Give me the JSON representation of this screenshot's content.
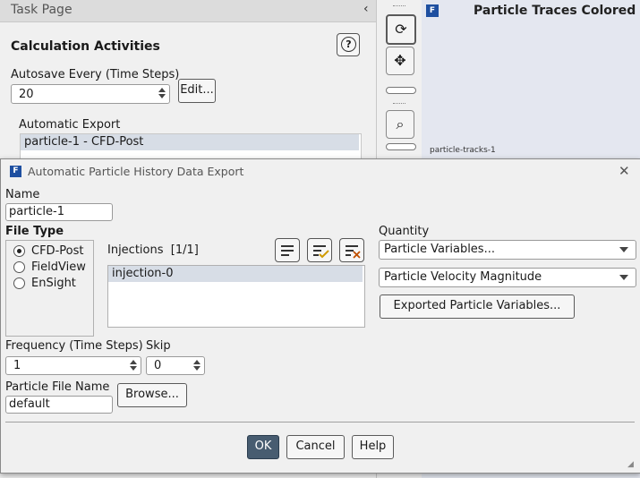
{
  "task_page": {
    "title": "Task Page",
    "collapse_glyph": "‹",
    "heading": "Calculation Activities",
    "autosave_label": "Autosave Every (Time Steps)",
    "autosave_value": "20",
    "edit_label": "Edit...",
    "automatic_export_label": "Automatic Export",
    "automatic_export_items": [
      "particle-1 - CFD-Post"
    ]
  },
  "graphics": {
    "title": "Particle Traces Colored b",
    "subtitle": "particle-tracks-1"
  },
  "dialog": {
    "title": "Automatic Particle History Data Export",
    "name_label": "Name",
    "name_value": "particle-1",
    "file_type_label": "File Type",
    "file_types": [
      "CFD-Post",
      "FieldView",
      "EnSight"
    ],
    "file_type_selected": "CFD-Post",
    "injections_label": "Injections",
    "injections_count": "[1/1]",
    "injections": [
      "injection-0"
    ],
    "quantity_label": "Quantity",
    "quantity_value": "Particle Variables...",
    "variable_value": "Particle Velocity Magnitude",
    "exported_vars_label": "Exported Particle Variables...",
    "frequency_label": "Frequency (Time Steps)",
    "frequency_value": "1",
    "skip_label": "Skip",
    "skip_value": "0",
    "particle_file_label": "Particle File Name",
    "particle_file_value": "default",
    "browse_label": "Browse...",
    "ok_label": "OK",
    "cancel_label": "Cancel",
    "help_label": "Help"
  },
  "icons": {
    "help": "?",
    "close": "✕",
    "rotate": "⟳",
    "pan": "✥",
    "zoom": "⌕",
    "logo": "F"
  }
}
